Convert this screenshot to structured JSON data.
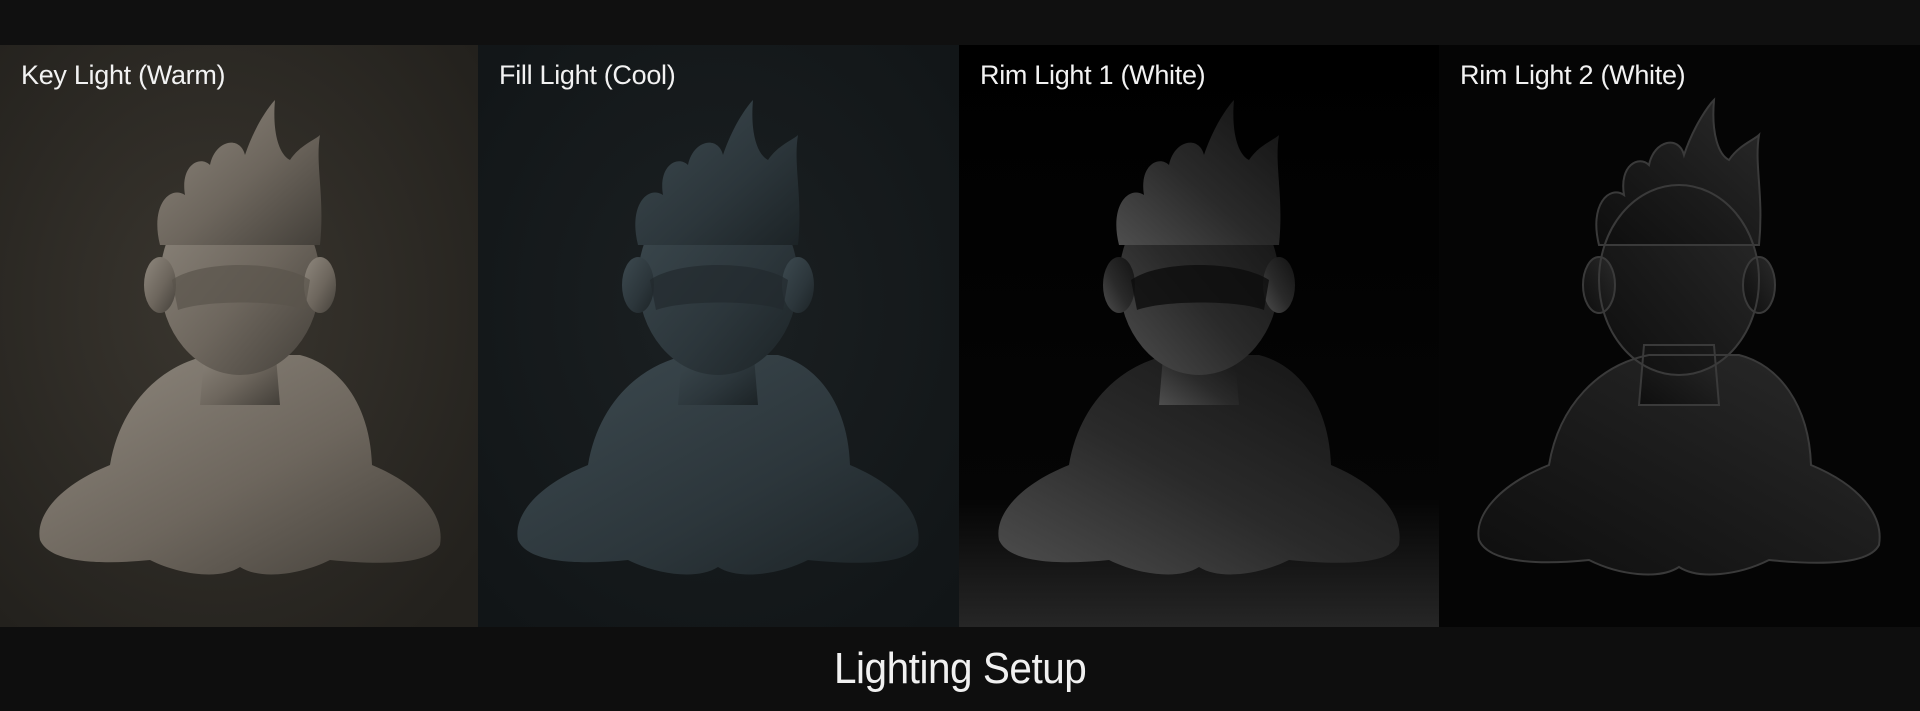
{
  "caption": "Lighting Setup",
  "panels": [
    {
      "label": "Key Light (Warm)"
    },
    {
      "label": "Fill Light (Cool)"
    },
    {
      "label": "Rim Light 1 (White)"
    },
    {
      "label": "Rim Light 2 (White)"
    }
  ]
}
